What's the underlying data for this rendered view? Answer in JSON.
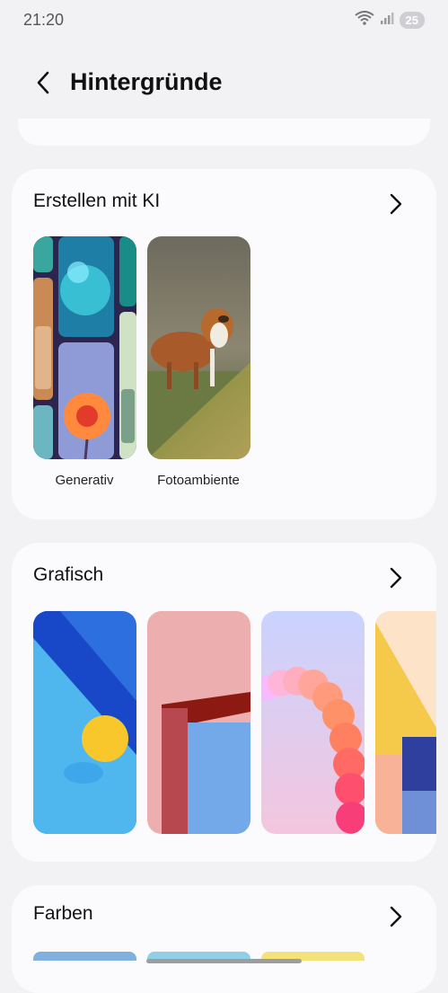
{
  "status": {
    "time": "21:20",
    "battery": "25"
  },
  "header": {
    "title": "Hintergründe"
  },
  "sections": {
    "ai": {
      "title": "Erstellen mit KI",
      "items": [
        {
          "label": "Generativ"
        },
        {
          "label": "Fotoambiente"
        }
      ]
    },
    "graphic": {
      "title": "Grafisch"
    },
    "colors": {
      "title": "Farben"
    }
  }
}
